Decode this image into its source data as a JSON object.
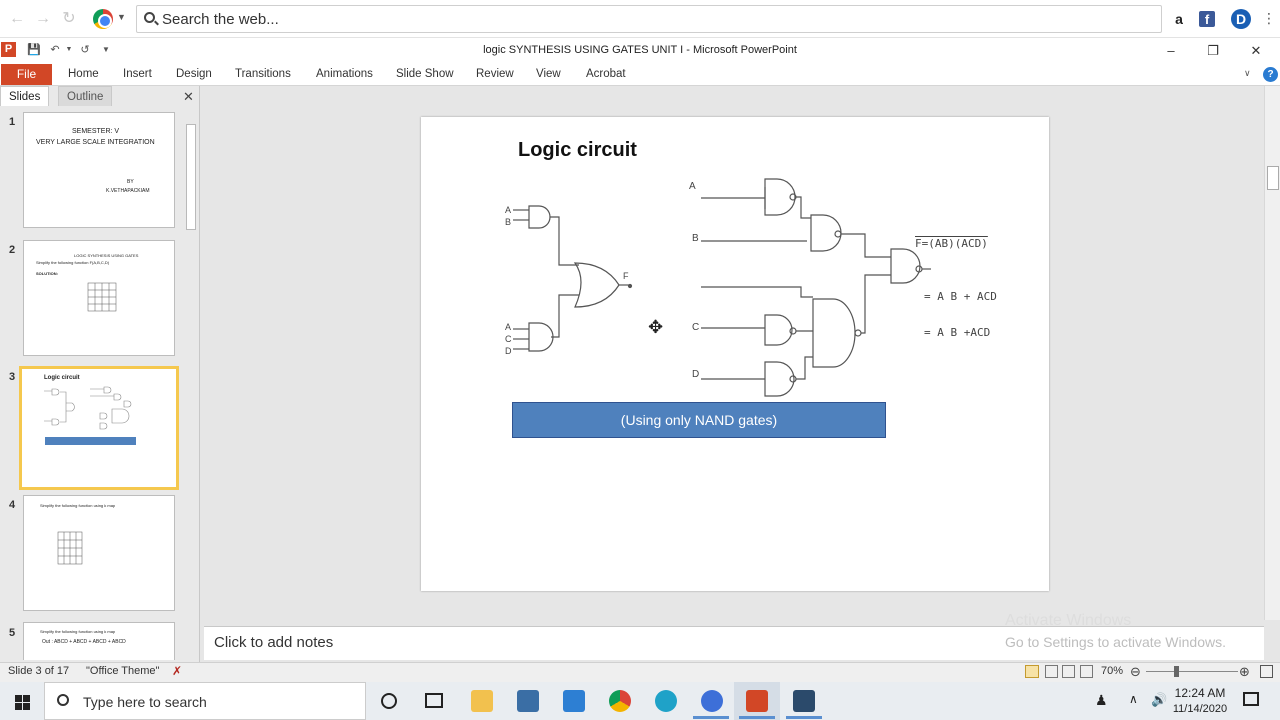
{
  "browser": {
    "search_placeholder": "Search the web...",
    "ext_amazon": "a",
    "ext_facebook": "f",
    "ext_profile": "D"
  },
  "app": {
    "title": "logic SYNTHESIS USING GATES UNIT I  -  Microsoft PowerPoint",
    "tabs": [
      "File",
      "Home",
      "Insert",
      "Design",
      "Transitions",
      "Animations",
      "Slide Show",
      "Review",
      "View",
      "Acrobat"
    ]
  },
  "left_pane": {
    "tab_slides": "Slides",
    "tab_outline": "Outline",
    "thumbnails": [
      {
        "num": "1",
        "lines": [
          "SEMESTER: V",
          "VERY LARGE SCALE INTEGRATION",
          "BY",
          "K.VETHAPACKIAM"
        ]
      },
      {
        "num": "2",
        "lines": [
          "LOGIC SYNTHESIS USING GATES",
          "Simplify the following function F(A,B,C,D)",
          "SOLUTION:"
        ]
      },
      {
        "num": "3",
        "lines": [
          "Logic circuit"
        ]
      },
      {
        "num": "4",
        "lines": [
          "Simplify the following function  using k map"
        ]
      },
      {
        "num": "5",
        "lines": [
          "Simplify the following function  using k map",
          "Out : ABCD + ABCD + ABCD + ABCD"
        ]
      }
    ]
  },
  "slide": {
    "title": "Logic circuit",
    "banner": "(Using only NAND gates)",
    "labels": {
      "a": "A",
      "b": "B",
      "c": "C",
      "d": "D",
      "f": "F",
      "eq1": "F=(AB)(ACD)",
      "eq2": "= A B + ACD",
      "eq3": "= A B +ACD"
    }
  },
  "notes": {
    "placeholder": "Click to add notes"
  },
  "watermark": {
    "line1": "Activate Windows",
    "line2": "Go to Settings to activate Windows."
  },
  "status": {
    "slide_info": "Slide 3 of 17",
    "theme": "\"Office Theme\"",
    "zoom": "70%"
  },
  "taskbar": {
    "search_placeholder": "Type here to search",
    "time": "12:24 AM",
    "date": "11/14/2020"
  }
}
